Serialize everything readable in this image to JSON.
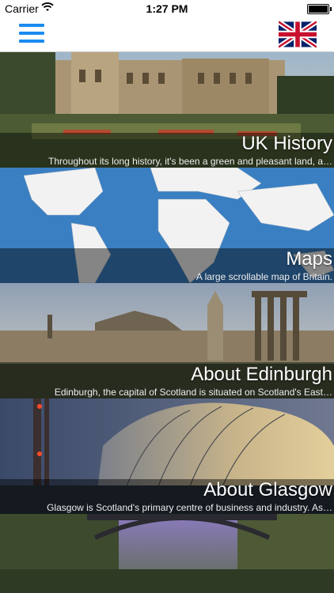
{
  "status": {
    "carrier": "Carrier",
    "time": "1:27 PM"
  },
  "nav": {
    "menu_icon": "hamburger-menu-icon",
    "flag_icon": "uk-flag-icon"
  },
  "cells": [
    {
      "title": "UK History",
      "subtitle": "Throughout its long history, it's been a green and pleasant land, a…"
    },
    {
      "title": "Maps",
      "subtitle": "A large scrollable map of Britain."
    },
    {
      "title": "About Edinburgh",
      "subtitle": "Edinburgh, the capital of Scotland is situated on Scotland's East…"
    },
    {
      "title": "About Glasgow",
      "subtitle": "Glasgow is Scotland's primary centre of business and industry. As…"
    }
  ],
  "colors": {
    "accent": "#1a8bf0",
    "flag_blue": "#012169",
    "flag_red": "#C8102E"
  }
}
